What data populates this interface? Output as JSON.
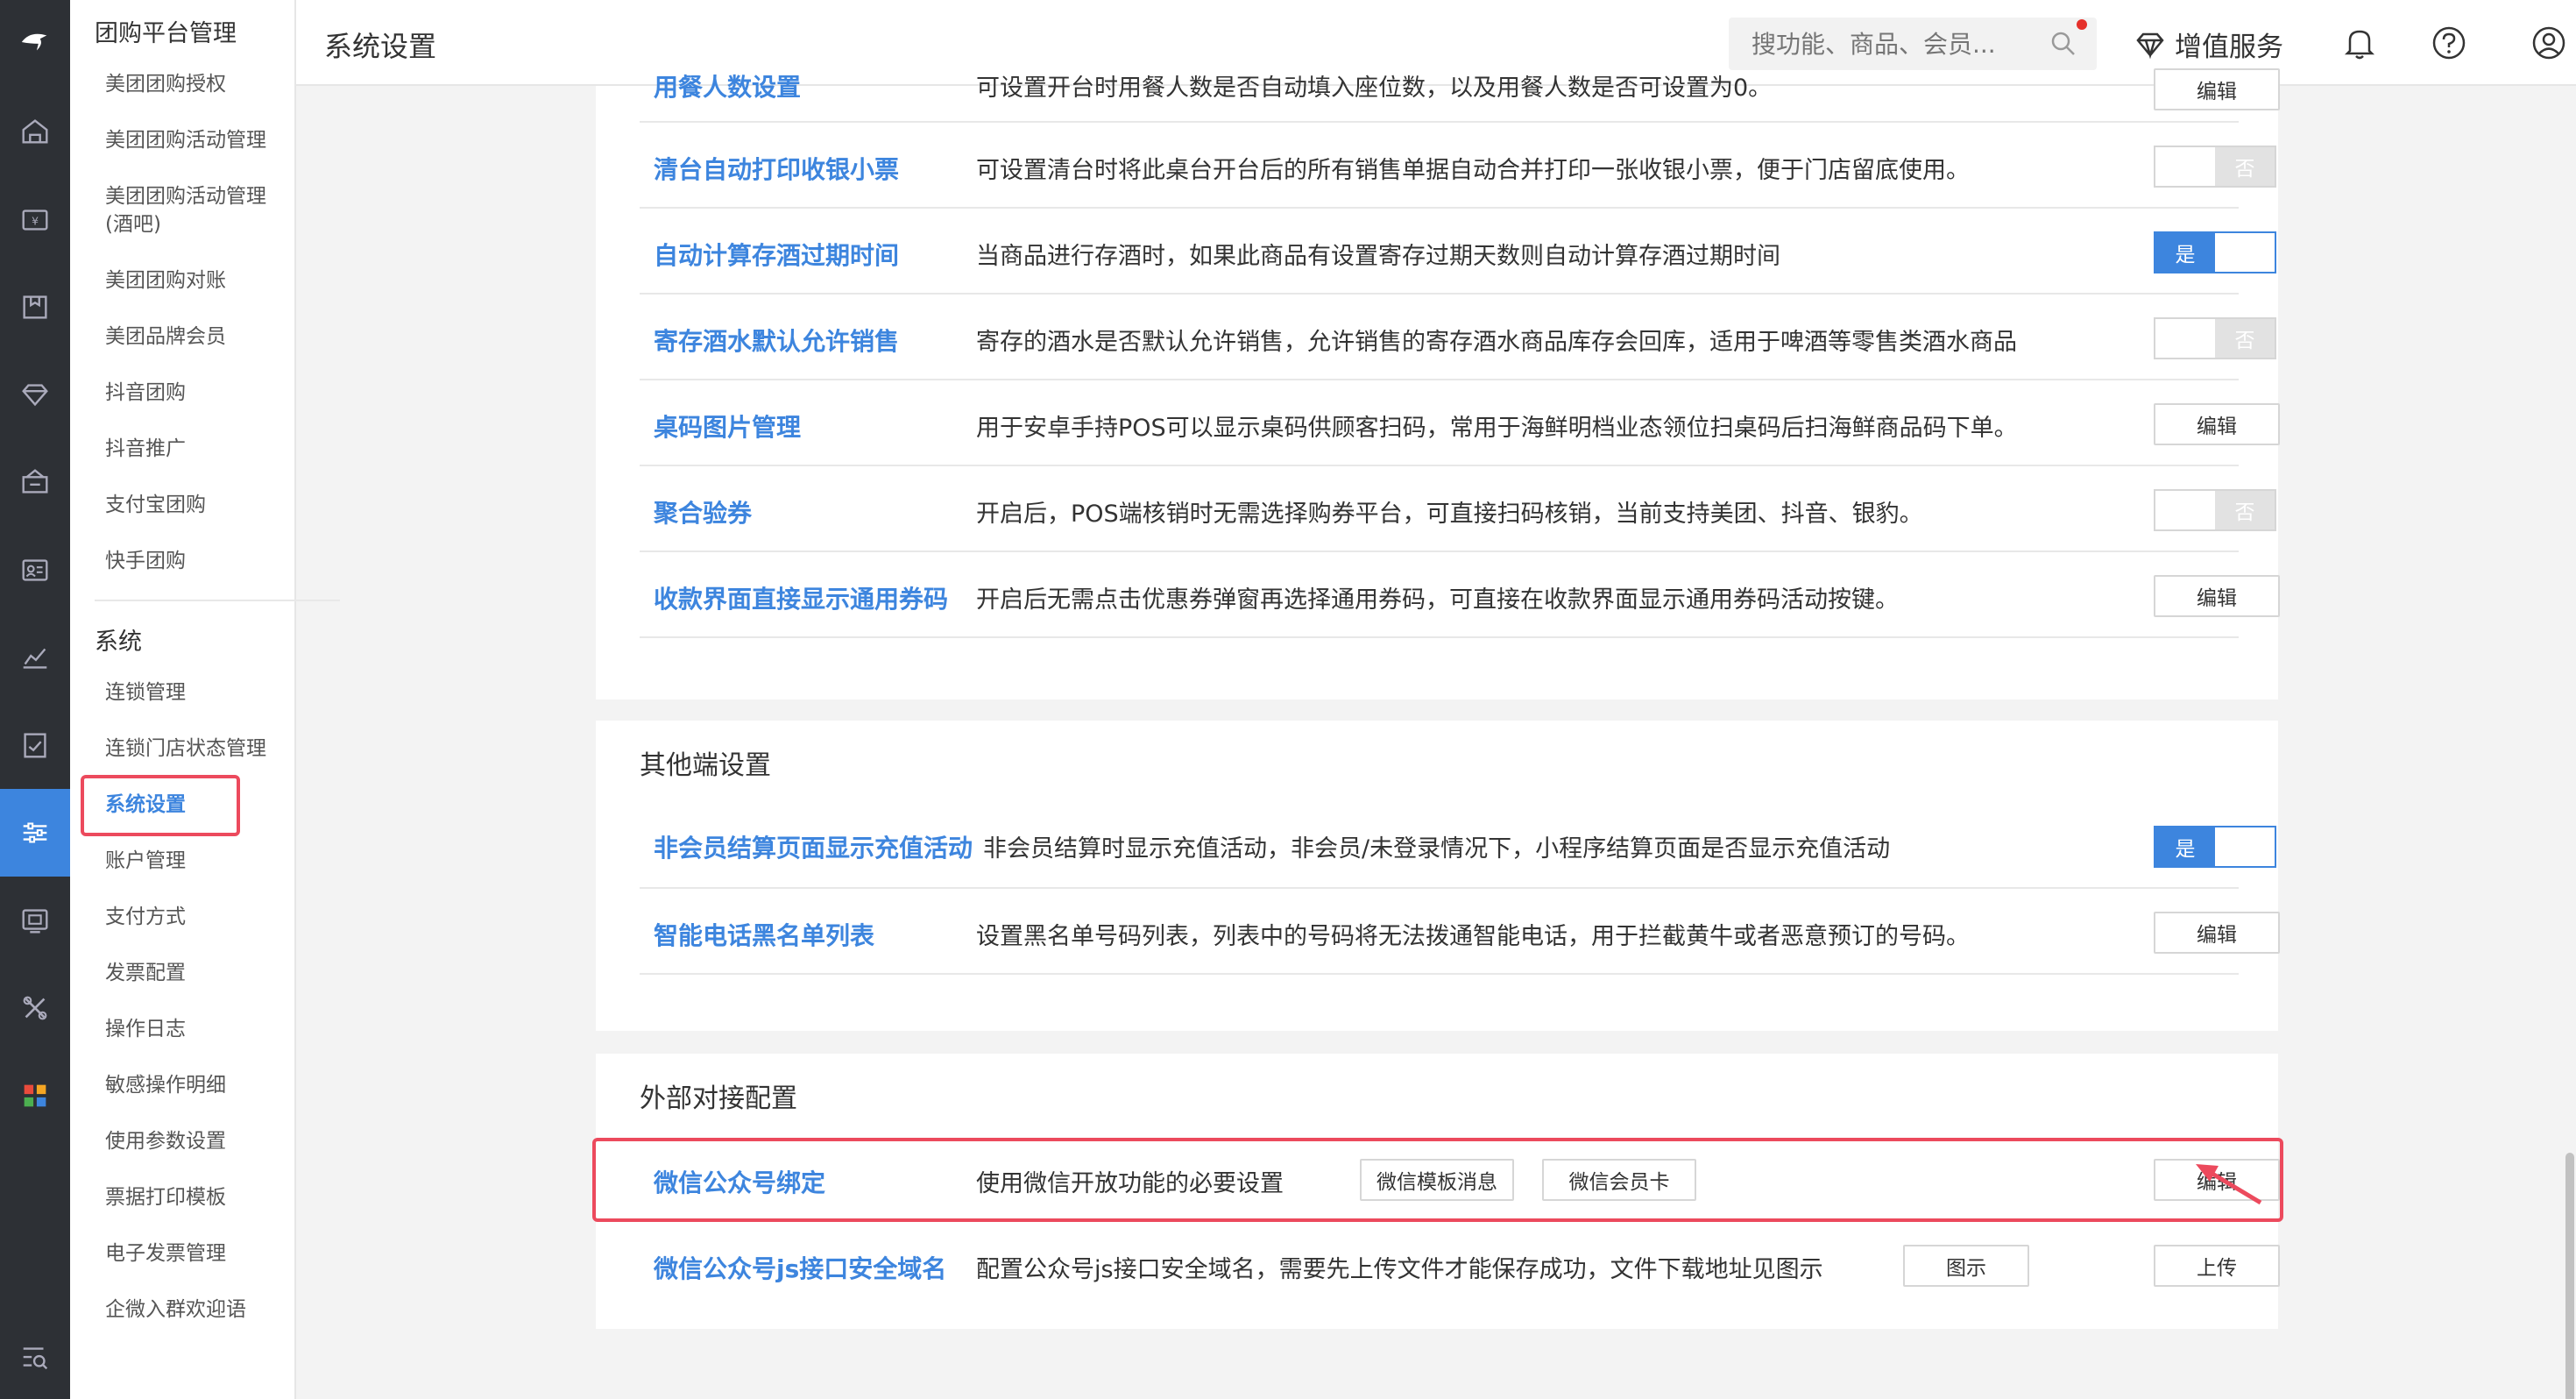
{
  "topbar": {
    "title": "系统设置",
    "search_placeholder": "搜功能、商品、会员...",
    "value_added_label": "增值服务"
  },
  "sidebar": {
    "group1_title": "团购平台管理",
    "group1_items": [
      "美团团购授权",
      "美团团购活动管理",
      "美团团购活动管理(酒吧)",
      "美团团购对账",
      "美团品牌会员",
      "抖音团购",
      "抖音推广",
      "支付宝团购",
      "快手团购"
    ],
    "group2_title": "系统",
    "group2_items": [
      "连锁管理",
      "连锁门店状态管理",
      "系统设置",
      "账户管理",
      "支付方式",
      "发票配置",
      "操作日志",
      "敏感操作明细",
      "使用参数设置",
      "票据打印模板",
      "电子发票管理",
      "企微入群欢迎语"
    ],
    "active_item": "系统设置"
  },
  "section1": {
    "partial_row": {
      "name": "用餐人数设置",
      "desc": "可设置开台时用餐人数是否自动填入座位数，以及用餐人数是否可设置为0。",
      "button": "编辑"
    },
    "rows": [
      {
        "name": "清台自动打印收银小票",
        "desc": "可设置清台时将此桌台开台后的所有销售单据自动合并打印一张收银小票，便于门店留底使用。",
        "control": "toggle",
        "state": "否"
      },
      {
        "name": "自动计算存酒过期时间",
        "desc": "当商品进行存酒时，如果此商品有设置寄存过期天数则自动计算存酒过期时间",
        "control": "toggle",
        "state": "是"
      },
      {
        "name": "寄存酒水默认允许销售",
        "desc": "寄存的酒水是否默认允许销售，允许销售的寄存酒水商品库存会回库，适用于啤酒等零售类酒水商品",
        "control": "toggle",
        "state": "否"
      },
      {
        "name": "桌码图片管理",
        "desc": "用于安卓手持POS可以显示桌码供顾客扫码，常用于海鲜明档业态领位扫桌码后扫海鲜商品码下单。",
        "control": "button",
        "button": "编辑"
      },
      {
        "name": "聚合验券",
        "desc": "开启后，POS端核销时无需选择购券平台，可直接扫码核销，当前支持美团、抖音、银豹。",
        "control": "toggle",
        "state": "否"
      },
      {
        "name": "收款界面直接显示通用券码",
        "desc": "开启后无需点击优惠券弹窗再选择通用券码，可直接在收款界面显示通用券码活动按键。",
        "control": "button",
        "button": "编辑"
      }
    ]
  },
  "section2": {
    "title": "其他端设置",
    "rows": [
      {
        "name": "非会员结算页面显示充值活动",
        "desc": "非会员结算时显示充值活动，非会员/未登录情况下，小程序结算页面是否显示充值活动",
        "control": "toggle",
        "state": "是"
      },
      {
        "name": "智能电话黑名单列表",
        "desc": "设置黑名单号码列表，列表中的号码将无法拨通智能电话，用于拦截黄牛或者恶意预订的号码。",
        "control": "button",
        "button": "编辑"
      }
    ]
  },
  "section3": {
    "title": "外部对接配置",
    "rows": [
      {
        "name": "微信公众号绑定",
        "desc": "使用微信开放功能的必要设置",
        "tags": [
          "微信模板消息",
          "微信会员卡"
        ],
        "button": "编辑"
      },
      {
        "name": "微信公众号js接口安全域名",
        "desc": "配置公众号js接口安全域名，需要先上传文件才能保存成功，文件下载地址见图示",
        "tags": [
          "图示"
        ],
        "button": "上传"
      }
    ]
  },
  "colors": {
    "accent": "#3d85de",
    "highlight": "#ec4a5d",
    "rail_bg": "#2d3035",
    "notify_dot": "#e5302a"
  },
  "icons": {
    "rail": [
      "logo-icon",
      "home-icon",
      "cashier-icon",
      "goods-icon",
      "member-icon",
      "marketing-icon",
      "staff-icon",
      "report-icon",
      "finance-icon",
      "settings-icon",
      "display-icon",
      "tools-icon",
      "apps-icon",
      "search-menu-icon"
    ],
    "topbar": [
      "search-icon",
      "diamond-icon",
      "bell-icon",
      "help-icon",
      "user-icon"
    ]
  }
}
